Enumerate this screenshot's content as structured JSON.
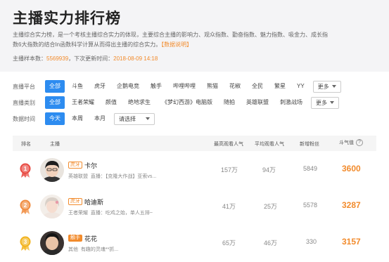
{
  "header": {
    "title": "主播实力排行榜",
    "desc_line1": "主播综合实力榜，是一个考核主播综合实力的体现，主要综合主播的影响力、观众指数、勤奋指数、魅力指数、吸金力、成长指",
    "desc_line2": "数6大指数的结合In函数科学计算从而得出主播的综合实力。",
    "desc_link": "【数据说明】",
    "sample_label": "主播样本数：",
    "sample_value": "5569939",
    "update_label": "，下次更新时间：",
    "update_value": "2018-08-09 14:18"
  },
  "filters": {
    "platform": {
      "label": "直播平台",
      "options": [
        "全部",
        "斗鱼",
        "虎牙",
        "企鹅电竞",
        "触手",
        "哔哩哔哩",
        "熊猫",
        "花椒",
        "全民",
        "繁星",
        "YY"
      ],
      "active": 0,
      "more": "更多"
    },
    "category": {
      "label": "直播类别",
      "options": [
        "全部",
        "王者荣耀",
        "颜值",
        "绝地求生",
        "《梦幻西游》电脑版",
        "随拍",
        "英雄联盟",
        "刺激战场"
      ],
      "active": 0,
      "more": "更多"
    },
    "time": {
      "label": "数据时间",
      "options": [
        "今天",
        "本周",
        "本月"
      ],
      "active": 0,
      "select_placeholder": "请选择"
    }
  },
  "table": {
    "headers": {
      "rank": "排名",
      "anchor": "主播",
      "peak": "最高观看人气",
      "avg": "平均观看人气",
      "fans": "新增粉丝",
      "score": "斗气值",
      "help": "?"
    },
    "rows": [
      {
        "rank": "1",
        "platform": "虎牙",
        "name": "卡尔",
        "category": "英雄联盟",
        "title": "直播：【克隆大作战】亚索vs...",
        "peak": "157万",
        "avg": "94万",
        "fans": "5849",
        "score": "3600"
      },
      {
        "rank": "2",
        "platform": "虎牙",
        "name": "哈迪斯",
        "category": "王者荣耀",
        "title": "直播：吃鸡之始，单人五排~",
        "peak": "41万",
        "avg": "25万",
        "fans": "5578",
        "score": "3287"
      },
      {
        "rank": "3",
        "platform": "触手",
        "name": "花花",
        "category": "其他",
        "title": "有趣的灵魂**抓...",
        "peak": "65万",
        "avg": "46万",
        "fans": "330",
        "score": "3157"
      }
    ]
  },
  "colors": {
    "accent": "#f28b2c",
    "active_blue": "#2d8cf0",
    "medal_red": "#e8473f",
    "medal_orange": "#f08a3c",
    "medal_gold": "#f2b21a"
  }
}
